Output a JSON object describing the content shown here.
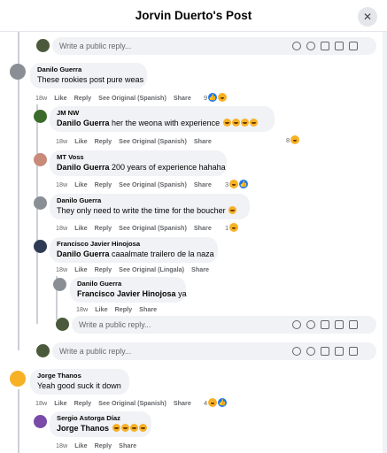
{
  "header": {
    "title": "Jorvin Duerto's Post",
    "close_icon": "close-icon"
  },
  "reply_placeholder": "Write a public reply...",
  "actions": {
    "like": "Like",
    "reply": "Reply",
    "share": "Share"
  },
  "comments": [
    {
      "name": "Danilo Guerra",
      "tag": "",
      "text": "These rookies post pure weas",
      "time": "18w",
      "see_original": "See Original (Spanish)",
      "reactions": "9"
    },
    {
      "name": "JM NW",
      "tag": "Danilo Guerra",
      "text": "her the weona with experience",
      "time": "18w",
      "see_original": "See Original (Spanish)",
      "reactions": "8"
    },
    {
      "name": "MT Voss",
      "tag": "Danilo Guerra",
      "text": "200 years of experience hahaha",
      "time": "18w",
      "see_original": "See Original (Spanish)",
      "reactions": "3"
    },
    {
      "name": "Danilo Guerra",
      "tag": "",
      "text": "They only need to write the time for the boucher",
      "time": "18w",
      "see_original": "See Original (Spanish)",
      "reactions": "1"
    },
    {
      "name": "Francisco Javier Hinojosa",
      "tag": "Danilo Guerra",
      "text": "caaalmate trailero de la naza",
      "time": "18w",
      "see_original": "See Original (Lingala)",
      "reactions": ""
    },
    {
      "name": "Danilo Guerra",
      "tag": "Francisco Javier Hinojosa",
      "text": "ya",
      "time": "18w",
      "see_original": "",
      "reactions": ""
    },
    {
      "name": "Jorge Thanos",
      "tag": "",
      "text": "Yeah good suck it down",
      "time": "18w",
      "see_original": "See Original (Spanish)",
      "reactions": "4"
    },
    {
      "name": "Sergio Astorga Díaz",
      "tag": "Jorge Thanos",
      "text": "",
      "time": "18w",
      "see_original": "",
      "reactions": ""
    }
  ],
  "colors": {
    "like_blue": "#1877f2",
    "haha_yellow": "#f7b125",
    "bubble_bg": "#f0f2f5",
    "meta_gray": "#65676b"
  }
}
